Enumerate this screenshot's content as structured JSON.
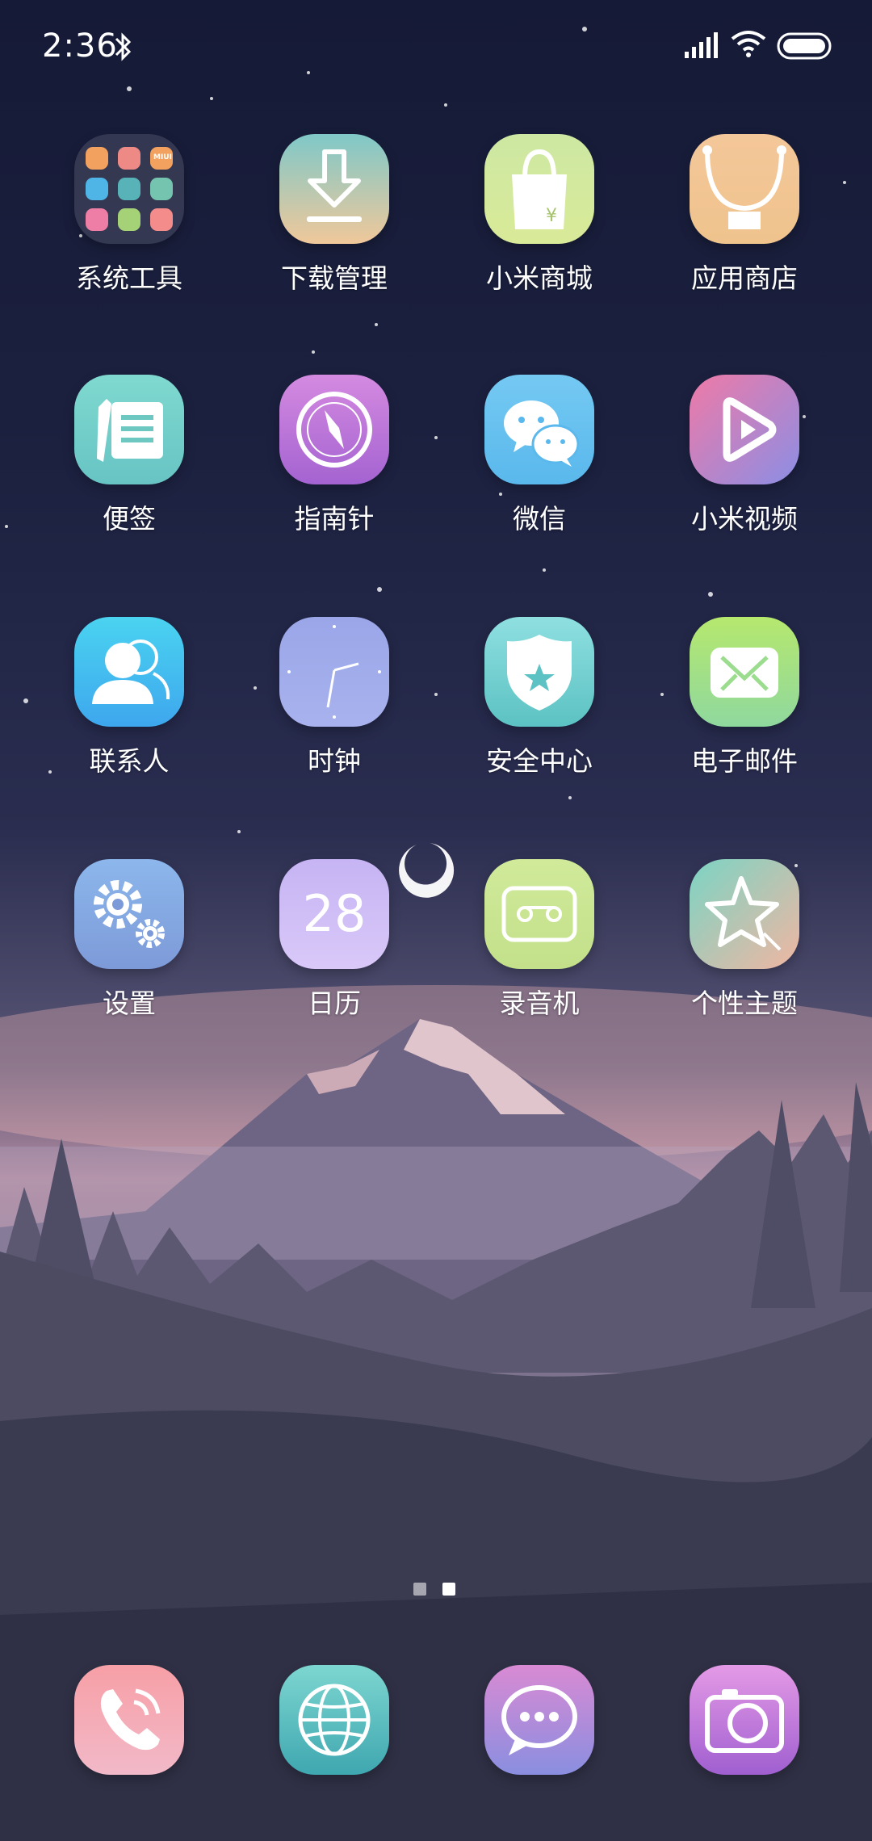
{
  "status_bar": {
    "time": "2:36",
    "icons": [
      "bluetooth-icon",
      "signal-icon",
      "wifi-icon",
      "battery-icon"
    ]
  },
  "home_grid": [
    {
      "label": "系统工具",
      "icon": "folder-icon"
    },
    {
      "label": "下载管理",
      "icon": "download-icon"
    },
    {
      "label": "小米商城",
      "icon": "shopping-bag-icon"
    },
    {
      "label": "应用商店",
      "icon": "app-store-icon"
    },
    {
      "label": "便签",
      "icon": "notes-icon"
    },
    {
      "label": "指南针",
      "icon": "compass-icon"
    },
    {
      "label": "微信",
      "icon": "wechat-icon"
    },
    {
      "label": "小米视频",
      "icon": "video-icon"
    },
    {
      "label": "联系人",
      "icon": "contacts-icon"
    },
    {
      "label": "时钟",
      "icon": "clock-icon"
    },
    {
      "label": "安全中心",
      "icon": "security-icon"
    },
    {
      "label": "电子邮件",
      "icon": "mail-icon"
    },
    {
      "label": "设置",
      "icon": "settings-icon"
    },
    {
      "label": "日历",
      "icon": "calendar-icon",
      "date": "28"
    },
    {
      "label": "录音机",
      "icon": "recorder-icon"
    },
    {
      "label": "个性主题",
      "icon": "themes-icon"
    }
  ],
  "folder_mini_icons": [
    "MIUI"
  ],
  "page_indicator": {
    "pages": 2,
    "current": 2
  },
  "dock": [
    {
      "icon": "phone-icon"
    },
    {
      "icon": "browser-icon"
    },
    {
      "icon": "messages-icon"
    },
    {
      "icon": "camera-icon"
    }
  ]
}
